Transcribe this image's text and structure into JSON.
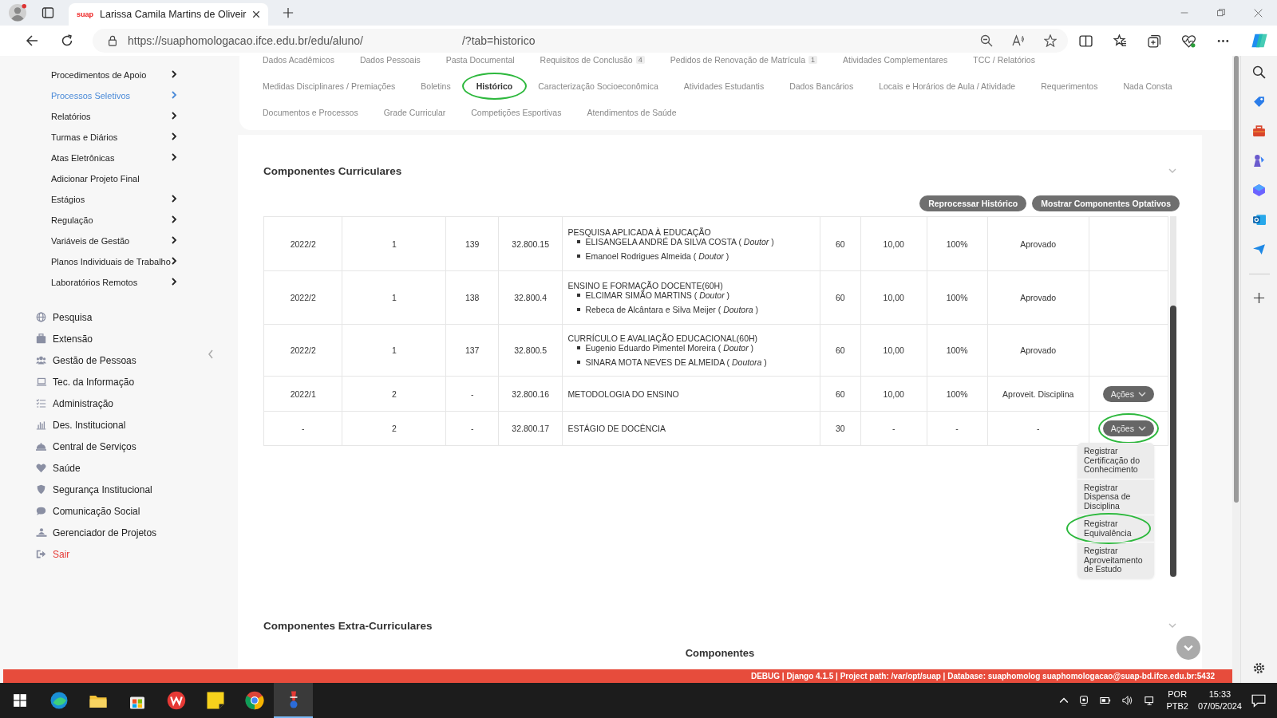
{
  "browser": {
    "favicon": "suap",
    "tab_title": "Larissa Camila Martins de Oliveir",
    "url_start": "https://suaphomologacao.ifce.edu.br/edu/aluno/",
    "url_end": "/?tab=historico"
  },
  "sidebar": {
    "subitems": [
      {
        "label": "Procedimentos de Apoio",
        "has_submenu": true,
        "selected": false
      },
      {
        "label": "Processos Seletivos",
        "has_submenu": true,
        "selected": true
      },
      {
        "label": "Relatórios",
        "has_submenu": true,
        "selected": false
      },
      {
        "label": "Turmas e Diários",
        "has_submenu": true,
        "selected": false
      },
      {
        "label": "Atas Eletrônicas",
        "has_submenu": true,
        "selected": false
      },
      {
        "label": "Adicionar Projeto Final",
        "has_submenu": false,
        "selected": false
      },
      {
        "label": "Estágios",
        "has_submenu": true,
        "selected": false
      },
      {
        "label": "Regulação",
        "has_submenu": true,
        "selected": false
      },
      {
        "label": "Variáveis de Gestão",
        "has_submenu": true,
        "selected": false
      },
      {
        "label": "Planos Individuais de Trabalho",
        "has_submenu": true,
        "selected": false
      },
      {
        "label": "Laboratórios Remotos",
        "has_submenu": true,
        "selected": false
      }
    ],
    "modules": [
      {
        "label": "Pesquisa",
        "kind": "module"
      },
      {
        "label": "Extensão",
        "kind": "module"
      },
      {
        "label": "Gestão de Pessoas",
        "kind": "module"
      },
      {
        "label": "Tec. da Informação",
        "kind": "module"
      },
      {
        "label": "Administração",
        "kind": "module"
      },
      {
        "label": "Des. Institucional",
        "kind": "module"
      },
      {
        "label": "Central de Serviços",
        "kind": "module"
      },
      {
        "label": "Saúde",
        "kind": "module"
      },
      {
        "label": "Segurança Institucional",
        "kind": "module"
      },
      {
        "label": "Comunicação Social",
        "kind": "module"
      },
      {
        "label": "Gerenciador de Projetos",
        "kind": "module"
      },
      {
        "label": "Sair",
        "kind": "exit"
      }
    ]
  },
  "tab_rows": [
    [
      {
        "label": "Dados Acadêmicos",
        "selected": false,
        "circled": false
      },
      {
        "label": "Dados Pessoais",
        "selected": false,
        "circled": false
      },
      {
        "label": "Pasta Documental",
        "selected": false,
        "circled": false
      },
      {
        "label": "Requisitos de Conclusão",
        "count": "4",
        "selected": false,
        "circled": false
      },
      {
        "label": "Pedidos de Renovação de Matrícula",
        "count": "1",
        "selected": false,
        "circled": false
      },
      {
        "label": "Atividades Complementares",
        "selected": false,
        "circled": false
      },
      {
        "label": "TCC / Relatórios",
        "selected": false,
        "circled": false
      }
    ],
    [
      {
        "label": "Medidas Disciplinares / Premiações",
        "selected": false,
        "circled": false
      },
      {
        "label": "Boletins",
        "selected": false,
        "circled": false
      },
      {
        "label": "Histórico",
        "selected": true,
        "circled": true
      },
      {
        "label": "Caracterização Socioeconômica",
        "selected": false,
        "circled": false
      },
      {
        "label": "Atividades Estudantis",
        "selected": false,
        "circled": false
      },
      {
        "label": "Dados Bancários",
        "selected": false,
        "circled": false
      },
      {
        "label": "Locais e Horários de Aula / Atividade",
        "selected": false,
        "circled": false
      },
      {
        "label": "Requerimentos",
        "selected": false,
        "circled": false
      },
      {
        "label": "Nada Consta",
        "selected": false,
        "circled": false
      }
    ],
    [
      {
        "label": "Documentos e Processos",
        "selected": false,
        "circled": false
      },
      {
        "label": "Grade Curricular",
        "selected": false,
        "circled": false
      },
      {
        "label": "Competições Esportivas",
        "selected": false,
        "circled": false
      },
      {
        "label": "Atendimentos de Saúde",
        "selected": false,
        "circled": false
      }
    ]
  ],
  "curriculares": {
    "title": "Componentes Curriculares",
    "buttons": [
      "Reprocessar Histórico",
      "Mostrar Componentes Optativos"
    ],
    "rows": [
      {
        "column_1": "2022/2",
        "column_2": "1",
        "column_3": "139",
        "column_4": "32.800.15",
        "component": "PESQUISA APLICADA À EDUCAÇÃO",
        "teachers": [
          "ELISANGELA ANDRÉ DA SILVA COSTA ( *Doutor* )",
          "Emanoel Rodrigues Almeida ( *Doutor* )"
        ],
        "column_6": "60",
        "column_7": "10,00",
        "column_8": "100%",
        "column_9": "Aprovado"
      },
      {
        "column_1": "2022/2",
        "column_2": "1",
        "column_3": "138",
        "column_4": "32.800.4",
        "component": "ENSINO E FORMAÇÃO DOCENTE(60H)",
        "teachers": [
          "ELCIMAR SIMÃO MARTINS ( *Doutor* )",
          "Rebeca de Alcântara e Silva Meijer ( *Doutora* )"
        ],
        "column_6": "60",
        "column_7": "10,00",
        "column_8": "100%",
        "column_9": "Aprovado"
      },
      {
        "column_1": "2022/2",
        "column_2": "1",
        "column_3": "137",
        "column_4": "32.800.5",
        "component": "CURRÍCULO E AVALIAÇÃO EDUCACIONAL(60H)",
        "teachers": [
          "Eugenio Eduardo Pimentel Moreira ( *Doutor* )",
          "SINARA MOTA NEVES DE ALMEIDA ( *Doutora* )"
        ],
        "column_6": "60",
        "column_7": "10,00",
        "column_8": "100%",
        "column_9": "Aprovado"
      },
      {
        "column_1": "2022/1",
        "column_2": "2",
        "column_3": "-",
        "column_4": "32.800.16",
        "component": "METODOLOGIA DO ENSINO",
        "column_6": "60",
        "column_7": "10,00",
        "column_8": "100%",
        "column_9": "Aproveit. Disciplina",
        "actions": {
          "label": "Ações",
          "circled": false
        }
      },
      {
        "column_1": "-",
        "column_2": "2",
        "column_3": "-",
        "column_4": "32.800.17",
        "component": "ESTÁGIO DE DOCÊNCIA",
        "column_6": "30",
        "column_7": "-",
        "column_8": "-",
        "column_9": "-",
        "actions": {
          "label": "Ações",
          "circled": true,
          "menu": [
            {
              "label": "Registrar Certificação do Conhecimento",
              "circled": false
            },
            {
              "label": "Registrar Dispensa de Disciplina",
              "circled": false
            },
            {
              "label": "Registrar Equivalência",
              "circled": true
            },
            {
              "label": "Registrar Aproveitamento de Estudo",
              "circled": false
            }
          ]
        }
      }
    ]
  },
  "extra": {
    "title": "Componentes Extra-Curriculares",
    "subtitle": "Componentes"
  },
  "debug_bar": "**DEBUG** | Django **4.1.5** | Project path: **/var/opt/suap** | Database: **suaphomolog suaphomologacao@suap-bd.ifce.edu.br:5432**",
  "taskbar": {
    "apps": [
      {
        "active": false
      },
      {
        "active": false
      },
      {
        "active": false
      },
      {
        "active": false
      },
      {
        "active": false
      },
      {
        "active": false
      },
      {
        "active": true
      }
    ],
    "tray": {
      "language": "POR",
      "layout": "PTB2",
      "time": "15:33",
      "date": "07/05/2024"
    }
  }
}
